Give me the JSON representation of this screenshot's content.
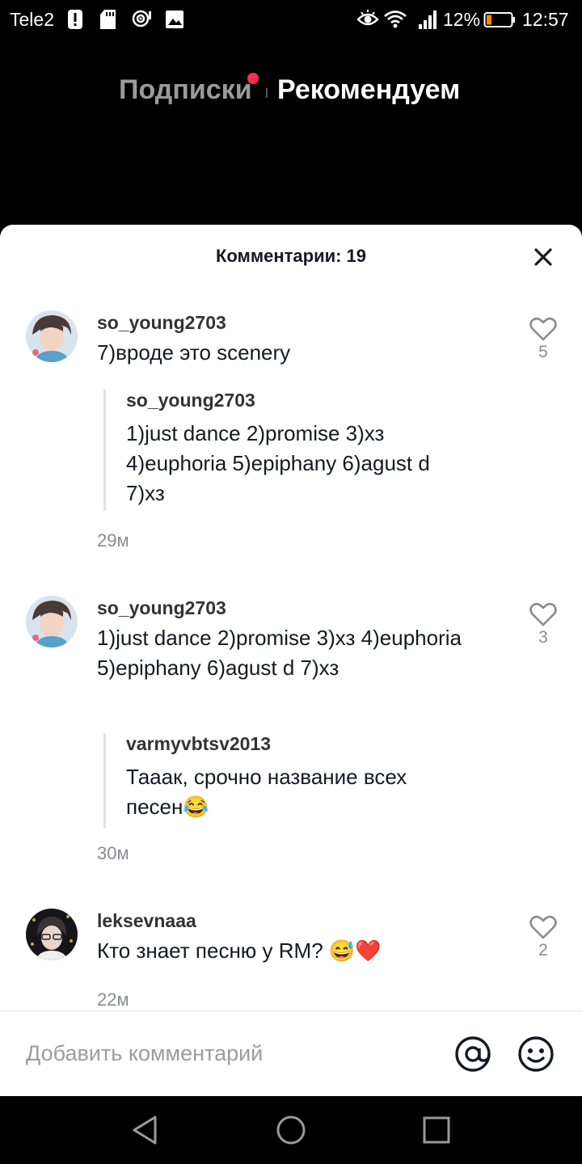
{
  "status_bar": {
    "carrier": "Tele2",
    "battery_percent": "12%",
    "time": "12:57"
  },
  "top_tabs": {
    "following": "Подписки",
    "for_you": "Рекомендуем"
  },
  "comments_sheet": {
    "title": "Комментарии: 19",
    "input_placeholder": "Добавить комментарий",
    "comments": [
      {
        "username": "so_young2703",
        "text": "7)вроде это scenery",
        "likes": "5",
        "time": "29м",
        "reply": {
          "username": "so_young2703",
          "text": "1)just dance 2)promise 3)хз 4)euphoria 5)epiphany 6)agust d 7)хз"
        }
      },
      {
        "username": "so_young2703",
        "text": "1)just dance 2)promise 3)хз 4)euphoria 5)epiphany 6)agust d 7)хз",
        "likes": "3",
        "time": "30м",
        "reply": {
          "username": "varmyvbtsv2013",
          "text": "Тааак, срочно название всех песен😂"
        }
      },
      {
        "username": "leksevnaaa",
        "text": "Кто знает песню у RM? 😅❤️",
        "likes": "2",
        "time": "22м"
      }
    ]
  },
  "icons": {
    "status": [
      "alert-icon",
      "sd-card-icon",
      "hotspot-icon",
      "gallery-icon",
      "eye-comfort-icon",
      "wifi-icon",
      "signal-icon",
      "battery-icon"
    ],
    "sheet": [
      "close-icon",
      "heart-icon",
      "at-icon",
      "emoji-icon"
    ],
    "nav": [
      "back-icon",
      "home-icon",
      "recents-icon"
    ]
  },
  "colors": {
    "accent_dot": "#fe2c55",
    "sheet_background": "#ffffff",
    "secondary_text": "#8a8b91"
  }
}
